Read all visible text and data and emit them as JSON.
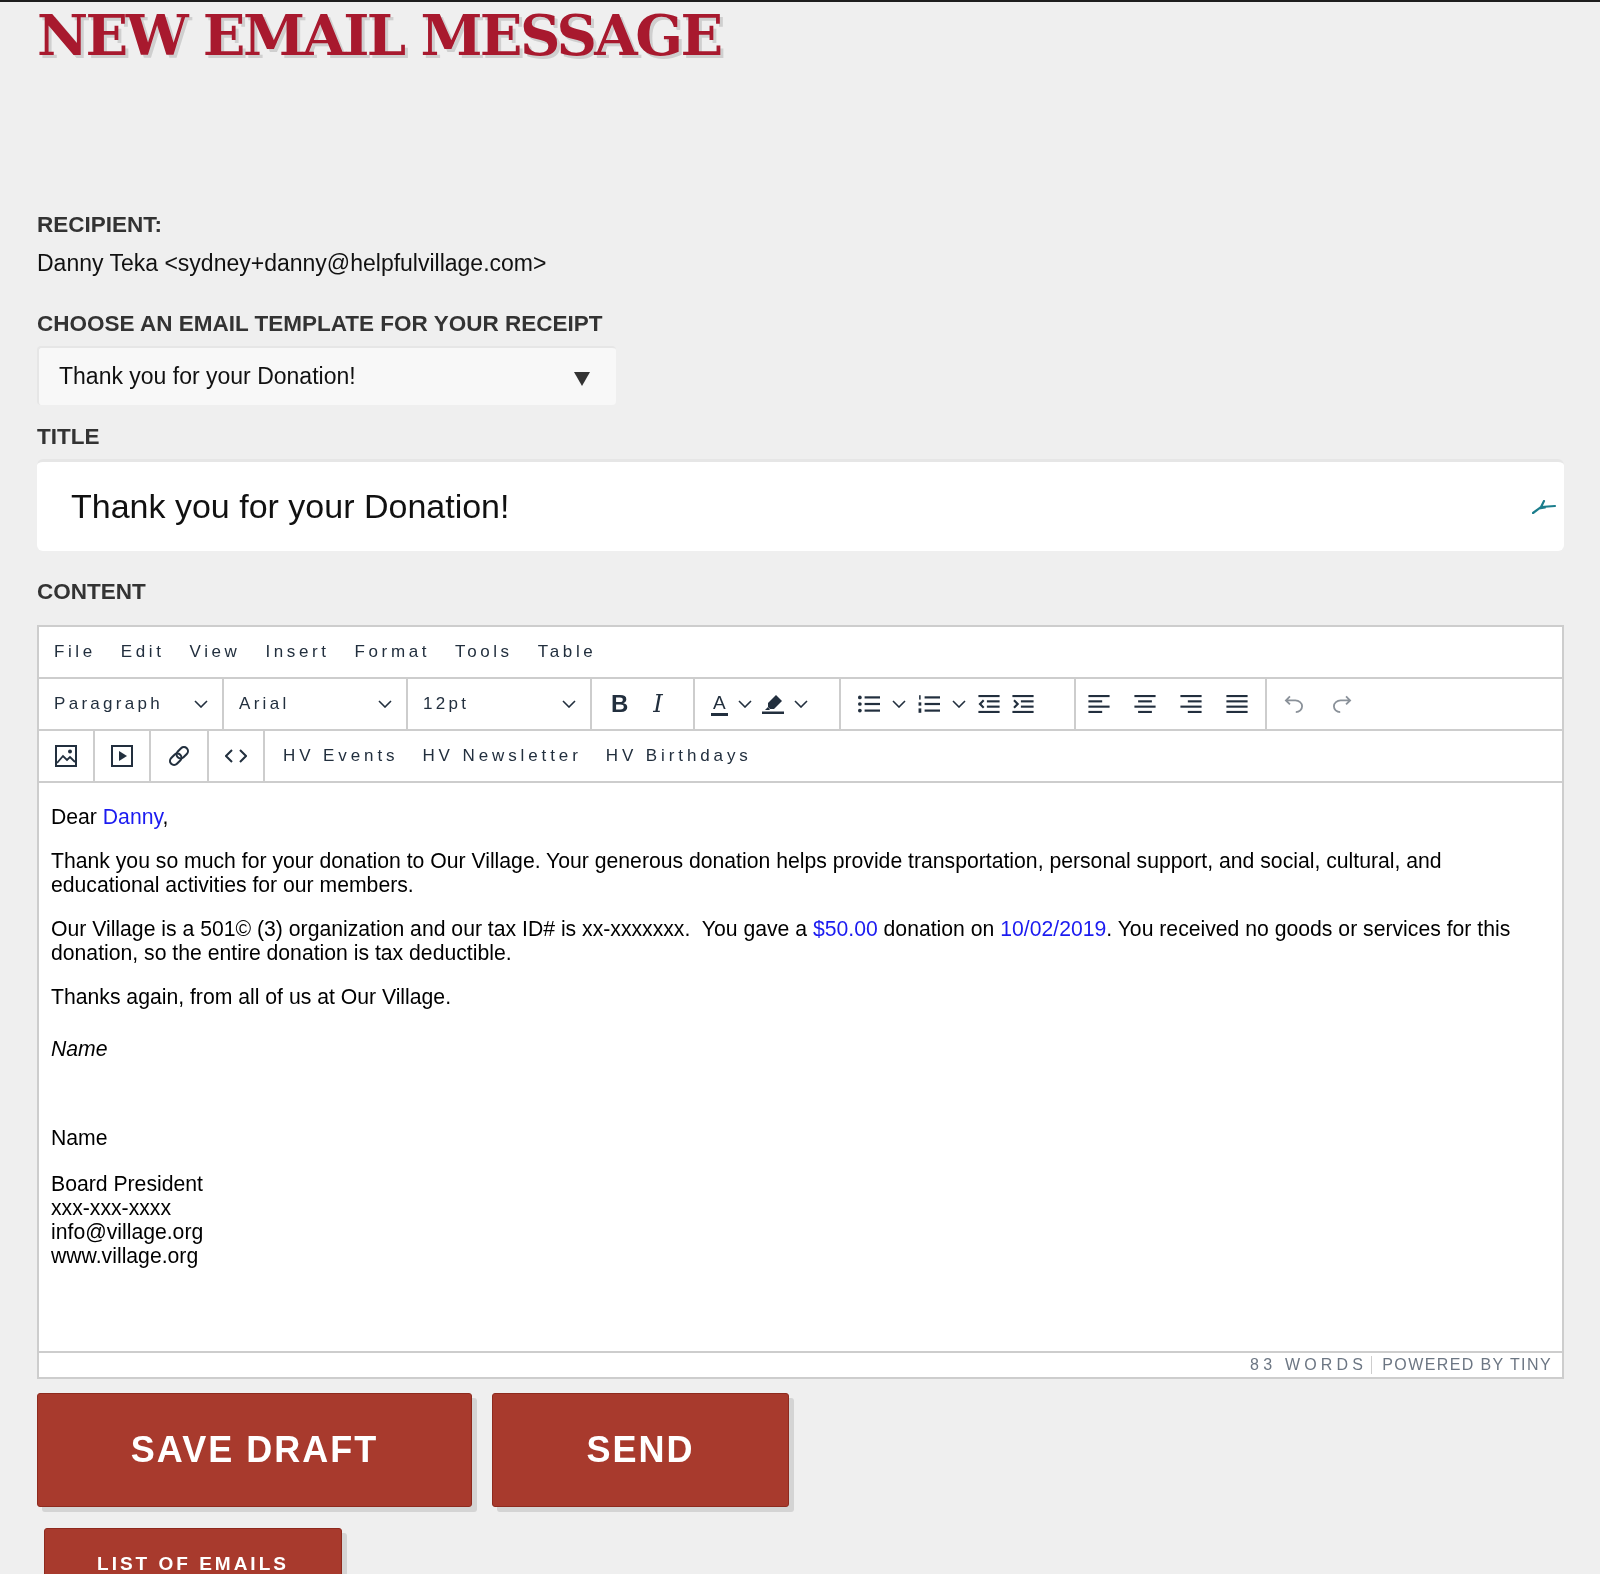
{
  "page": {
    "title": "NEW EMAIL MESSAGE"
  },
  "recipient": {
    "label": "RECIPIENT:",
    "value": "Danny Teka <sydney+danny@helpfulvillage.com>"
  },
  "template": {
    "label": "CHOOSE AN EMAIL TEMPLATE FOR YOUR RECEIPT",
    "value": "Thank you for your Donation!"
  },
  "title_field": {
    "label": "TITLE",
    "value": "Thank you for your Donation!"
  },
  "content": {
    "label": "CONTENT",
    "menu": [
      "File",
      "Edit",
      "View",
      "Insert",
      "Format",
      "Tools",
      "Table"
    ],
    "toolbar": {
      "dropdowns": [
        "Paragraph",
        "Arial",
        "12pt"
      ],
      "format_glyphs": [
        "B",
        "I"
      ],
      "text_color_glyph": "A",
      "insert_buttons": [
        "HV Events",
        "HV Newsletter",
        "HV Birthdays"
      ]
    },
    "body": [
      {
        "kind": "text",
        "segments": [
          {
            "text": "Dear ",
            "kind": "plain"
          },
          {
            "text": "Danny",
            "kind": "field"
          },
          {
            "text": ",",
            "kind": "plain"
          }
        ]
      },
      {
        "kind": "text",
        "segments": [
          {
            "text": "Thank you so much for your donation to Our Village. Your generous donation helps provide transportation, personal support, and social, cultural, and educational activities for our members.",
            "kind": "plain"
          }
        ]
      },
      {
        "kind": "text",
        "segments": [
          {
            "text": "Our Village is a 501© (3) organization and our tax ID# is xx-xxxxxxx.  You gave a ",
            "kind": "plain"
          },
          {
            "text": "$50.00",
            "kind": "field"
          },
          {
            "text": " donation on ",
            "kind": "plain"
          },
          {
            "text": "10/02/2019",
            "kind": "field"
          },
          {
            "text": ". You received no goods or services for this donation, so the entire donation is tax deductible.",
            "kind": "plain"
          }
        ]
      },
      {
        "kind": "text",
        "segments": [
          {
            "text": "Thanks again, from all of us at Our Village.",
            "kind": "plain"
          }
        ]
      },
      {
        "kind": "italic",
        "segments": [
          {
            "text": "Name",
            "kind": "plain"
          }
        ]
      },
      {
        "kind": "text",
        "segments": [
          {
            "text": "Name",
            "kind": "plain"
          }
        ]
      },
      {
        "kind": "lines",
        "lines": [
          "Board President",
          "xxx-xxx-xxxx",
          "info@village.org",
          "www.village.org"
        ]
      }
    ],
    "status": {
      "word_count": "83 WORDS",
      "branding": "POWERED BY TINY"
    }
  },
  "actions": [
    "SAVE DRAFT",
    "SEND"
  ],
  "list_button": "LIST OF EMAILS"
}
